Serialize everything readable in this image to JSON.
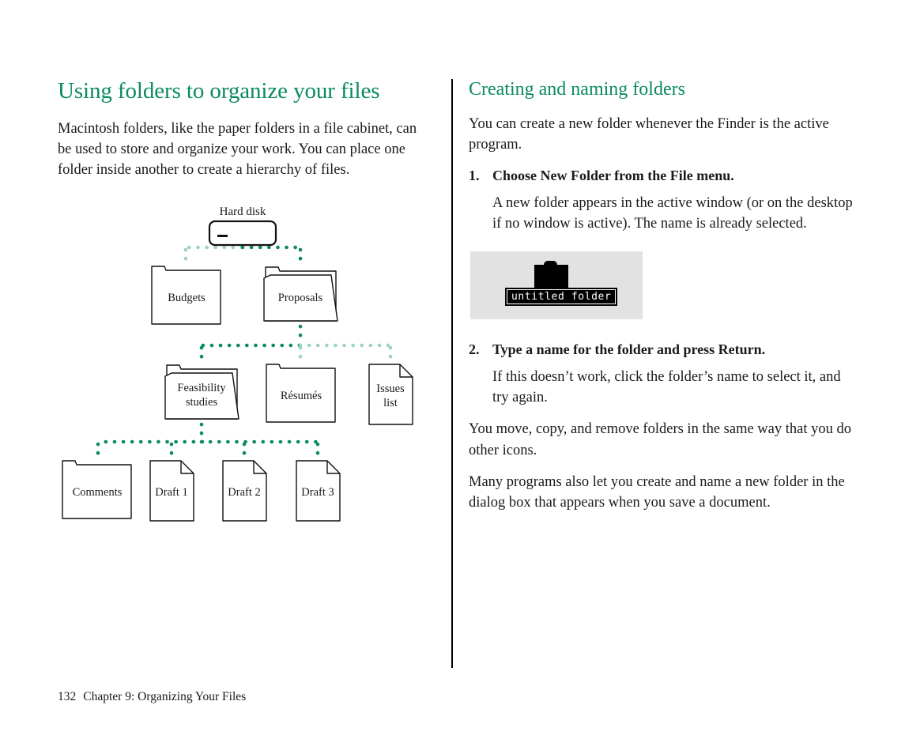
{
  "page": {
    "footer_number": "132",
    "footer_chapter": "Chapter 9: Organizing Your Files"
  },
  "colors": {
    "heading_green": "#0a8a63",
    "dot_dark": "#0d8a63",
    "dot_light": "#9ed3bf",
    "figure_background": "#e2e2e2",
    "ink": "#1a1a1a"
  },
  "left_column": {
    "title": "Using folders to organize your files",
    "paragraph": "Macintosh folders, like the paper folders in a file cabinet, can be used to store and organize your work. You can place one folder inside another to create a hierarchy of files."
  },
  "right_column": {
    "title": "Creating and naming folders",
    "intro": "You can create a new folder whenever the Finder is the active program.",
    "steps": [
      {
        "number": "1.",
        "heading": "Choose New Folder from the File menu.",
        "body": "A new folder appears in the active window (or on the desktop if no window is active). The name is already selected."
      },
      {
        "number": "2.",
        "heading": "Type a name for the folder and press Return.",
        "body": "If this doesn’t work, click the folder’s name to select it, and try again."
      }
    ],
    "closing_paragraphs": [
      "You move, copy, and remove folders in the same way that you do other icons.",
      "Many programs also let you create and name a new folder in the dialog box that appears when you save a document."
    ],
    "figure": {
      "icon_name": "mac-folder-icon",
      "selected_name": "untitled folder"
    }
  },
  "diagram": {
    "root": {
      "caption": "Hard disk",
      "icon": "hard-disk-icon"
    },
    "nodes": [
      {
        "id": "budgets",
        "label": "Budgets",
        "icon": "folder-closed-icon",
        "level": 1
      },
      {
        "id": "proposals",
        "label": "Proposals",
        "icon": "folder-open-icon",
        "level": 1
      },
      {
        "id": "feasibility",
        "label": "Feasibility studies",
        "icon": "folder-open-icon",
        "level": 2
      },
      {
        "id": "resumes",
        "label": "Résumés",
        "icon": "folder-closed-icon",
        "level": 2
      },
      {
        "id": "issues",
        "label": "Issues list",
        "icon": "document-icon",
        "level": 2
      },
      {
        "id": "comments",
        "label": "Comments",
        "icon": "folder-closed-icon",
        "level": 3
      },
      {
        "id": "draft1",
        "label": "Draft 1",
        "icon": "document-icon",
        "level": 3
      },
      {
        "id": "draft2",
        "label": "Draft 2",
        "icon": "document-icon",
        "level": 3
      },
      {
        "id": "draft3",
        "label": "Draft 3",
        "icon": "document-icon",
        "level": 3
      }
    ]
  }
}
